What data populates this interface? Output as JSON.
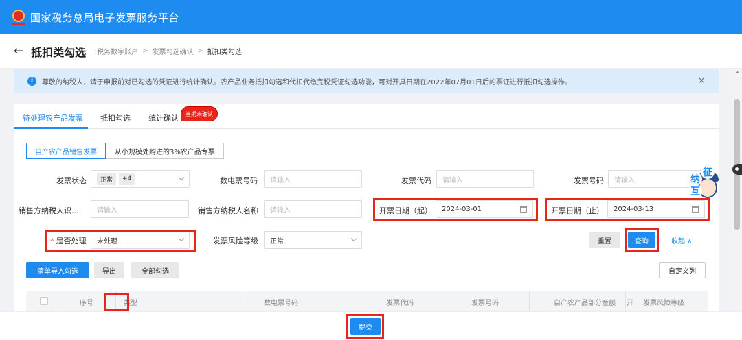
{
  "app": {
    "title": "国家税务总局电子发票服务平台"
  },
  "header": {
    "back_icon": "back-arrow-icon",
    "page_title": "抵扣类勾选",
    "breadcrumbs": [
      "税务数字账户",
      "发票勾选确认",
      "抵扣类勾选"
    ]
  },
  "notice": {
    "text": "尊敬的纳税人，请于申报前对已勾选的凭证进行统计确认。农产品业务抵扣勾选和代扣代缴完税凭证勾选功能，可对开具日期在2022年07月01日后的票证进行抵扣勾选操作。",
    "close": "×"
  },
  "tabs": [
    {
      "label": "待处理农产品发票",
      "active": true
    },
    {
      "label": "抵扣勾选",
      "active": false
    },
    {
      "label": "统计确认",
      "active": false
    }
  ],
  "tab_badge": "当期未确认",
  "subtabs": [
    {
      "label": "自产农产品销售发票",
      "active": true
    },
    {
      "label": "从小规模处购进的3%农产品专票",
      "active": false
    }
  ],
  "filters": {
    "invoice_status": {
      "label": "发票状态",
      "tags": [
        "正常",
        "+4"
      ]
    },
    "e_invoice_no": {
      "label": "数电票号码",
      "placeholder": "请输入"
    },
    "invoice_code": {
      "label": "发票代码",
      "placeholder": "请输入"
    },
    "invoice_no": {
      "label": "发票号码",
      "placeholder": "请输入"
    },
    "seller_tax_id": {
      "label": "销售方纳税人识...",
      "placeholder": "请输入"
    },
    "seller_name": {
      "label": "销售方纳税人名称",
      "placeholder": "请输入"
    },
    "date_start": {
      "label": "开票日期（起）",
      "value": "2024-03-01"
    },
    "date_end": {
      "label": "开票日期（止）",
      "value": "2024-03-13"
    },
    "processed": {
      "required_mark": "*",
      "label": "是否处理",
      "value": "未处理"
    },
    "risk_level": {
      "label": "发票风险等级",
      "value": "正常"
    }
  },
  "buttons": {
    "reset": "重置",
    "query": "查询",
    "collapse": "收起 ∧",
    "import_select": "清单导入勾选",
    "export": "导出",
    "select_all": "全部勾选",
    "custom_columns": "自定义列",
    "submit": "提交"
  },
  "table": {
    "columns": [
      "序号",
      "类型",
      "数电票号码",
      "发票代码",
      "发票号码",
      "自产农产品部分金额",
      "开",
      "发票风险等级"
    ]
  },
  "mascot": {
    "chars": [
      "征",
      "纳",
      "互"
    ]
  },
  "colors": {
    "brand": "#1e8bf0",
    "highlight": "#e8251c",
    "notice_bg": "#dcecfb"
  }
}
